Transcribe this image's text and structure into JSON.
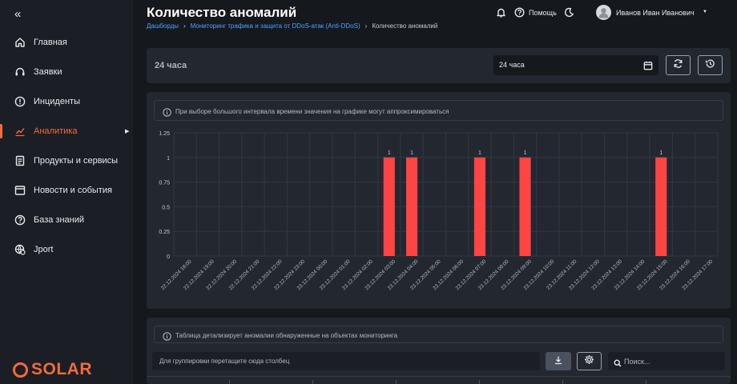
{
  "sidebar": {
    "collapse_glyph": "«",
    "items": [
      {
        "label": "Главная",
        "icon": "home-icon"
      },
      {
        "label": "Заявки",
        "icon": "headset-icon"
      },
      {
        "label": "Инциденты",
        "icon": "alert-circle-icon"
      },
      {
        "label": "Аналитика",
        "icon": "analytics-icon",
        "active": true
      },
      {
        "label": "Продукты и сервисы",
        "icon": "document-icon"
      },
      {
        "label": "Новости и события",
        "icon": "news-icon"
      },
      {
        "label": "База знаний",
        "icon": "question-icon"
      },
      {
        "label": "Jport",
        "icon": "settings-globe-icon"
      }
    ],
    "logo": "SOLAR"
  },
  "header": {
    "title": "Количество аномалий",
    "breadcrumb": [
      "Дашборды",
      "Мониторинг трафика и защита от DDoS-атак (Anti-DDoS)",
      "Количество аномалий"
    ],
    "help_label": "Помощь",
    "user_name": "Иванов Иван Иванович"
  },
  "period": {
    "label": "24 часа",
    "selected": "24 часа"
  },
  "chart_info": "При выборе большого интервала времени значения на графике могут аппроксимироваться",
  "chart_data": {
    "type": "bar",
    "ylim": [
      0,
      1.25
    ],
    "yticks": [
      "0",
      "0.25",
      "0.5",
      "0.75",
      "1",
      "1.25"
    ],
    "categories": [
      "22.12.2024 18:00",
      "22.12.2024 19:00",
      "22.12.2024 20:00",
      "22.12.2024 21:00",
      "22.12.2024 22:00",
      "22.12.2024 23:00",
      "23.12.2024 00:00",
      "23.12.2024 01:00",
      "23.12.2024 02:00",
      "23.12.2024 03:00",
      "23.12.2024 04:00",
      "23.12.2024 05:00",
      "23.12.2024 06:00",
      "23.12.2024 07:00",
      "23.12.2024 08:00",
      "23.12.2024 09:00",
      "23.12.2024 10:00",
      "23.12.2024 11:00",
      "23.12.2024 12:00",
      "23.12.2024 13:00",
      "23.12.2024 14:00",
      "23.12.2024 15:00",
      "23.12.2024 16:00",
      "23.12.2024 17:00"
    ],
    "values": [
      0,
      0,
      0,
      0,
      0,
      0,
      0,
      0,
      0,
      1,
      1,
      0,
      0,
      1,
      0,
      1,
      0,
      0,
      0,
      0,
      0,
      1,
      0,
      0
    ],
    "bar_color": "#ff4444",
    "grid": true
  },
  "table": {
    "info": "Таблица детализирует аномалии обнаруженные на объектах мониторинга",
    "group_placeholder": "Для группировки перетащите сюда столбец",
    "search_placeholder": "Поиск..."
  },
  "colors": {
    "accent": "#f26a3d",
    "link": "#4da3ff",
    "panel": "#232830",
    "background": "#15181d"
  }
}
